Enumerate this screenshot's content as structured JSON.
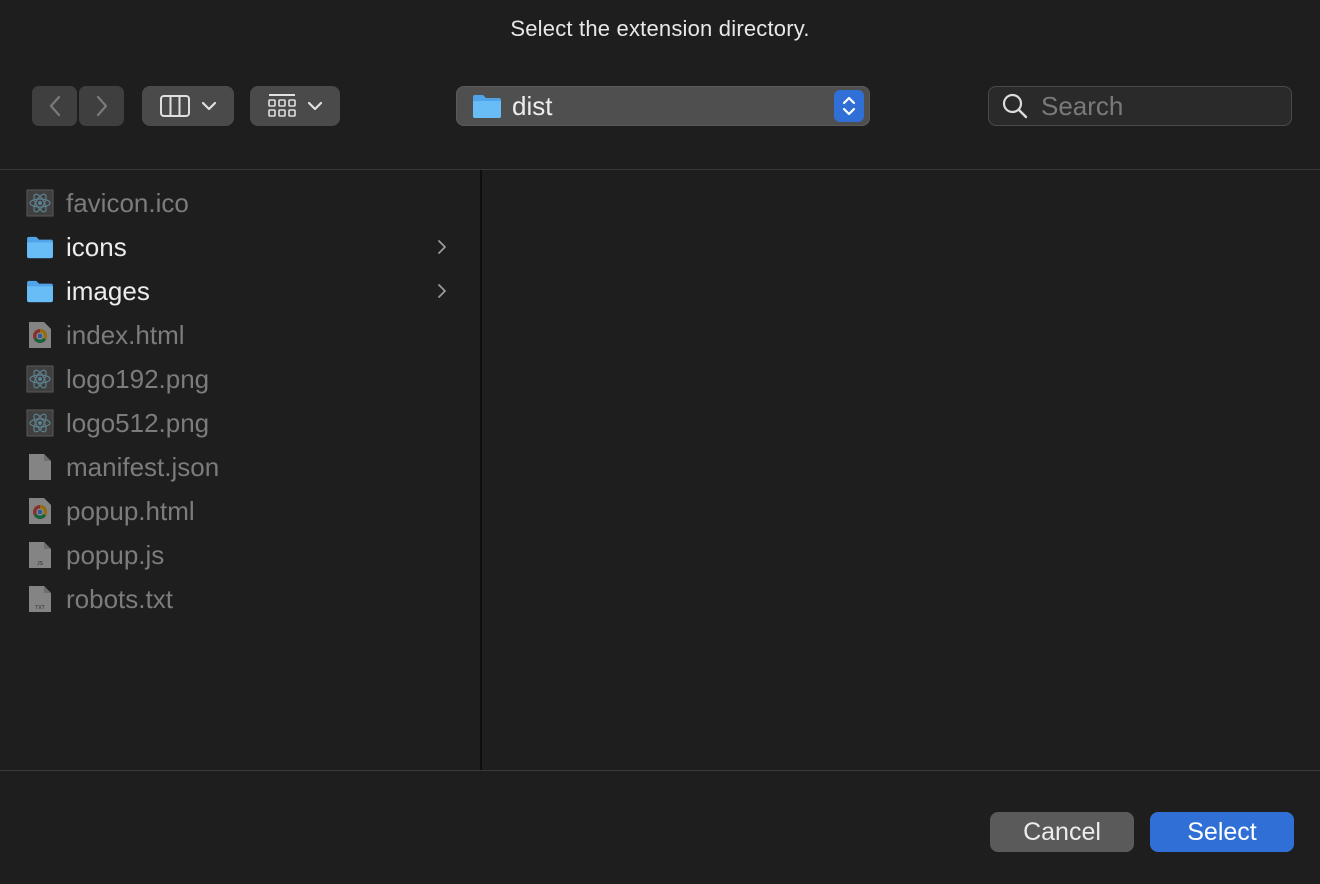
{
  "dialog": {
    "title": "Select the extension directory."
  },
  "toolbar": {
    "back_icon": "chevron-left-icon",
    "forward_icon": "chevron-right-icon",
    "view_icon": "column-view-icon",
    "group_icon": "group-grid-icon",
    "path": {
      "label": "dist",
      "icon": "folder-icon"
    },
    "search": {
      "placeholder": "Search",
      "value": ""
    }
  },
  "files": [
    {
      "name": "favicon.ico",
      "kind": "react",
      "enabled": false,
      "folder": false
    },
    {
      "name": "icons",
      "kind": "folder",
      "enabled": true,
      "folder": true
    },
    {
      "name": "images",
      "kind": "folder",
      "enabled": true,
      "folder": true
    },
    {
      "name": "index.html",
      "kind": "chrome",
      "enabled": false,
      "folder": false
    },
    {
      "name": "logo192.png",
      "kind": "react",
      "enabled": false,
      "folder": false
    },
    {
      "name": "logo512.png",
      "kind": "react",
      "enabled": false,
      "folder": false
    },
    {
      "name": "manifest.json",
      "kind": "document",
      "enabled": false,
      "folder": false
    },
    {
      "name": "popup.html",
      "kind": "chrome",
      "enabled": false,
      "folder": false
    },
    {
      "name": "popup.js",
      "kind": "js",
      "enabled": false,
      "folder": false
    },
    {
      "name": "robots.txt",
      "kind": "txt",
      "enabled": false,
      "folder": false
    }
  ],
  "file_badges": {
    "js": "JS",
    "txt": "TXT"
  },
  "footer": {
    "cancel_label": "Cancel",
    "select_label": "Select"
  },
  "colors": {
    "accent": "#2f6fd6",
    "folder": "#5fb4f2",
    "background": "#1e1e1e"
  }
}
